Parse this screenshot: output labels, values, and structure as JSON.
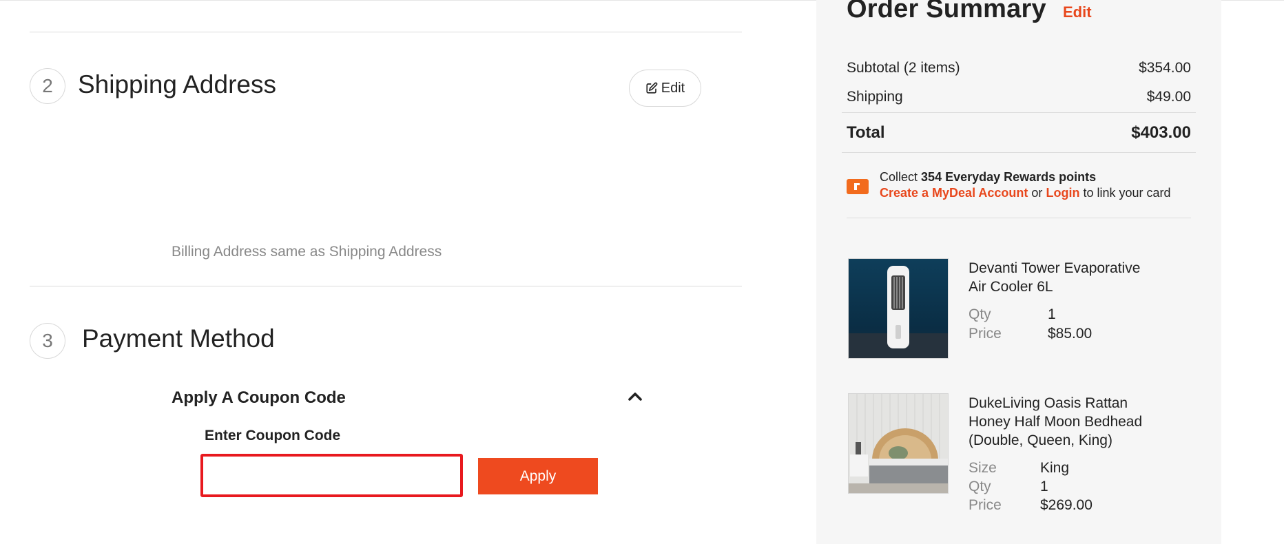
{
  "shipping": {
    "step_number": "2",
    "title": "Shipping Address",
    "edit_label": "Edit",
    "billing_note": "Billing Address same as Shipping Address"
  },
  "payment": {
    "step_number": "3",
    "title": "Payment Method",
    "coupon_section_label": "Apply A Coupon Code",
    "coupon_field_label": "Enter Coupon Code",
    "coupon_value": "",
    "apply_label": "Apply"
  },
  "summary": {
    "title": "Order Summary",
    "edit_label": "Edit",
    "subtotal_label": "Subtotal (2 items)",
    "subtotal_value": "$354.00",
    "shipping_label": "Shipping",
    "shipping_value": "$49.00",
    "total_label": "Total",
    "total_value": "$403.00",
    "rewards": {
      "collect_prefix": "Collect",
      "points_text": "354 Everyday Rewards points",
      "create_account_link": "Create a MyDeal Account",
      "or_text": "or",
      "login_link": "Login",
      "suffix_text": "to link your card"
    },
    "items": [
      {
        "name_line1": "Devanti Tower Evaporative",
        "name_line2": "Air Cooler 6L",
        "qty_label": "Qty",
        "qty": "1",
        "price_label": "Price",
        "price": "$85.00"
      },
      {
        "name_line1": "DukeLiving Oasis Rattan",
        "name_line2": "Honey Half Moon Bedhead",
        "name_line3": "(Double, Queen, King)",
        "size_label": "Size",
        "size": "King",
        "qty_label": "Qty",
        "qty": "1",
        "price_label": "Price",
        "price": "$269.00"
      }
    ]
  },
  "colors": {
    "accent": "#ee4a1f",
    "link": "#e8471c",
    "highlight_border": "#e8191e",
    "panel_bg": "#f6f6f6"
  },
  "icons": {
    "edit": "edit-icon",
    "chevron": "chevron-up-icon",
    "rewards": "rewards-card-icon"
  }
}
